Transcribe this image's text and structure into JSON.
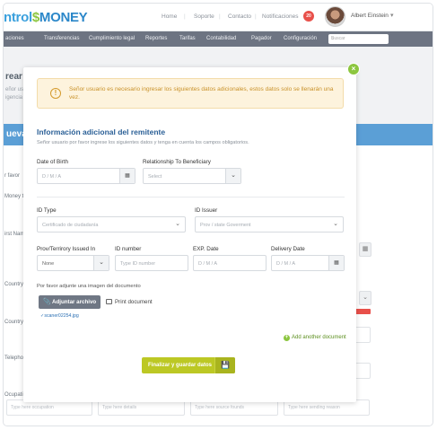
{
  "brand": {
    "part1": "ntrol",
    "part2": "$",
    "part3": "MONEY"
  },
  "topnav": {
    "home": "Home",
    "support": "Soporte",
    "contact": "Contacto",
    "notifications": "Notificaciones",
    "notif_count": "20",
    "user": "Albert Einstein"
  },
  "mainnav": {
    "items": [
      "aciones",
      "Transferencias",
      "Cumplimiento legal",
      "Reportes",
      "Tarifas",
      "Contabilidad",
      "Pagador",
      "Configuración"
    ],
    "search_placeholder": "Buscar"
  },
  "background": {
    "title": "rear",
    "sub1": "eñor us",
    "sub2": "igencia",
    "blue_head": "ueva",
    "labels": [
      "r favor",
      "Money t",
      "irst Nam",
      "Country",
      "Country",
      "Telepho",
      "Ocupati"
    ],
    "placeholders": [
      "Type here occupation",
      "Type here details",
      "Type here source founds",
      "Type here sending reason"
    ]
  },
  "modal": {
    "alert_text": "Señor usuario es necesario ingresar los siguientes datos adicionales, estos datos solo se llenarán una vez.",
    "section_title": "Información adicional del remitente",
    "section_sub": "Señor usuario por favor ingrese los siguientes datos y tenga en cuenta los campos obligatorios.",
    "dob": {
      "label": "Date of Birth",
      "placeholder": "D / M / A"
    },
    "relationship": {
      "label": "Relationship To Beneficiary",
      "placeholder": "Select"
    },
    "id_type": {
      "label": "ID Type",
      "placeholder": "Certificado de ciudadanía"
    },
    "id_issuer": {
      "label": "ID Issuer",
      "placeholder": "Prov / state Goverment"
    },
    "province": {
      "label": "Prov/Terrirory Issued In",
      "value": "None"
    },
    "id_number": {
      "label": "ID number",
      "placeholder": "Type ID number"
    },
    "exp_date": {
      "label": "EXP. Date",
      "placeholder": "D / M / A"
    },
    "delivery_date": {
      "label": "Delivery Date",
      "placeholder": "D / M / A"
    },
    "attach_note": "Por favor adjunte una imagen del documento",
    "attach_button": "Adjuntar archivo",
    "print_link": "Print document",
    "file_name": "scaner02254.jpg",
    "add_document": "Add another document",
    "save_button": "Finalizar y guardar datos"
  }
}
